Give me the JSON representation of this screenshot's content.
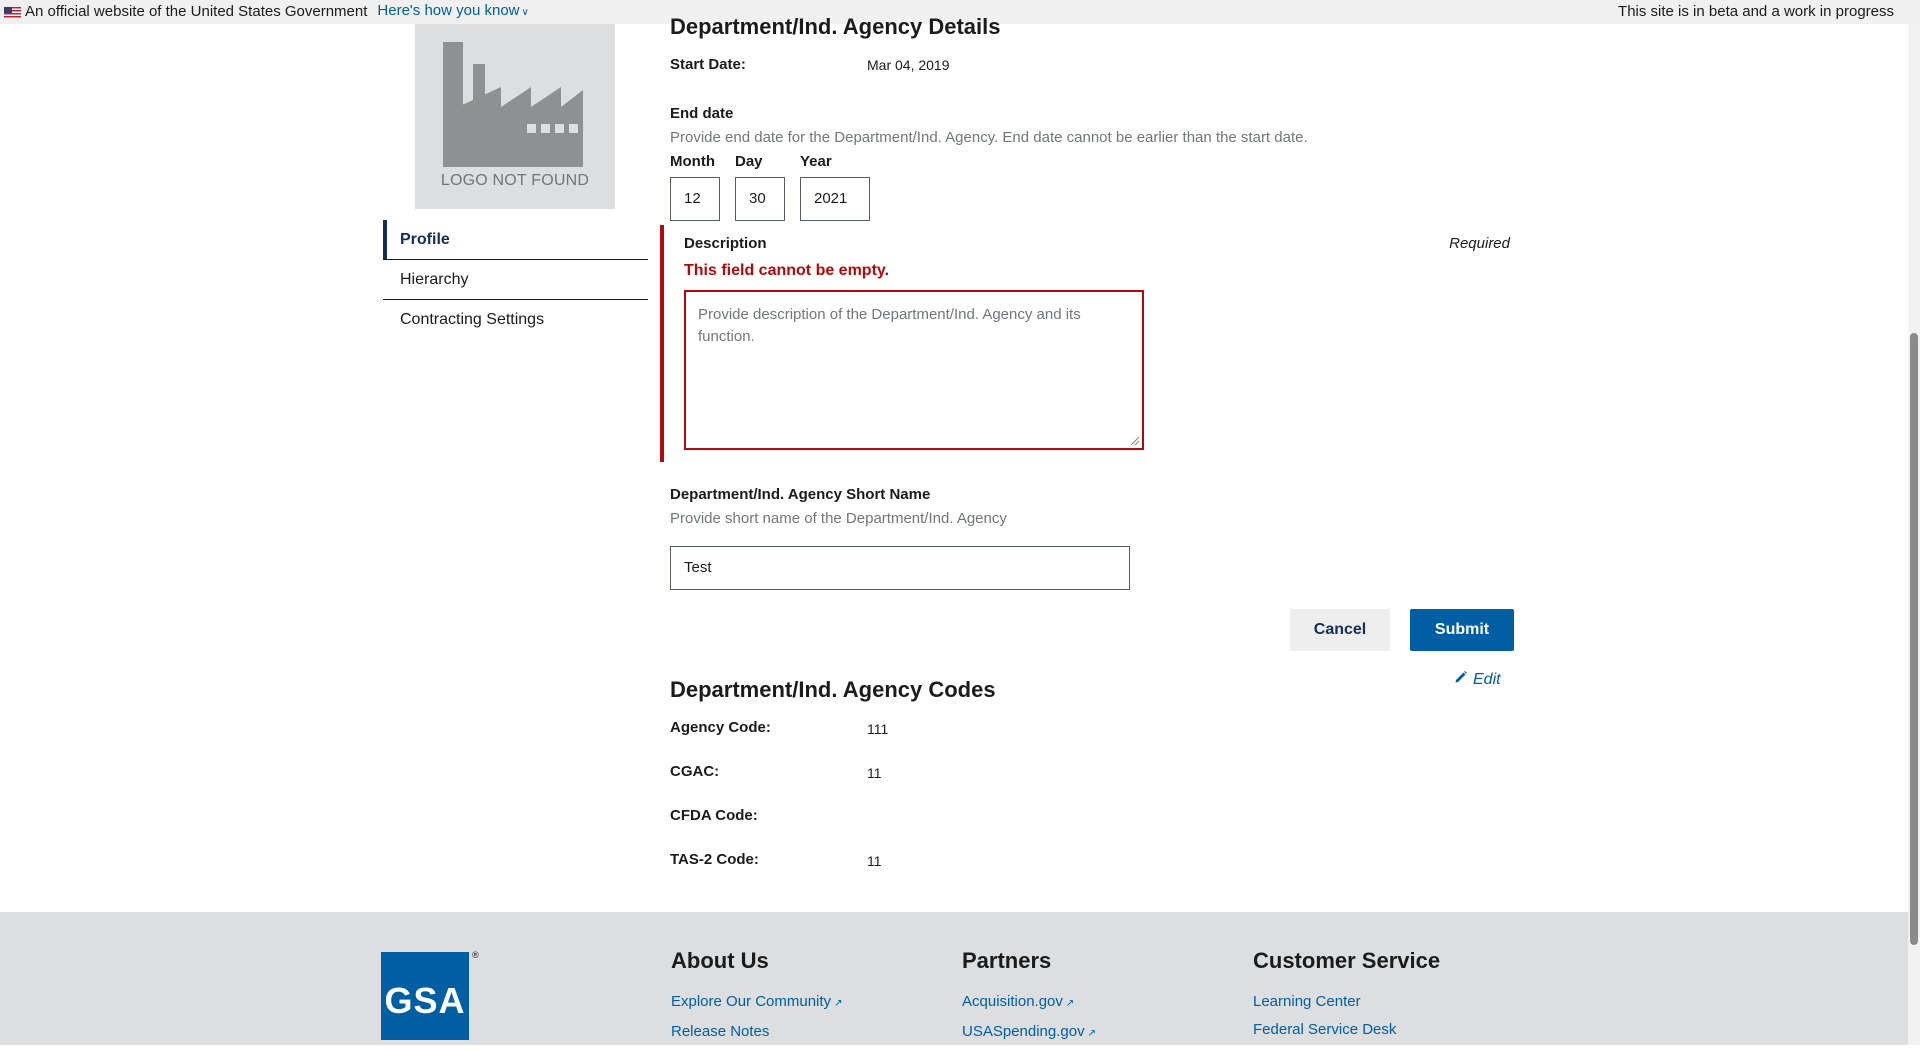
{
  "banner": {
    "official_text": "An official website of the United States Government",
    "how_know": "Here's how you know",
    "beta_text": "This site is in beta and a work in progress"
  },
  "sidebar": {
    "logo_caption": "LOGO NOT FOUND",
    "items": [
      {
        "label": "Profile"
      },
      {
        "label": "Hierarchy"
      },
      {
        "label": "Contracting Settings"
      }
    ]
  },
  "details": {
    "heading": "Department/Ind. Agency Details",
    "start_date_label": "Start Date:",
    "start_date_value": "Mar 04, 2019",
    "end_date_label": "End date",
    "end_date_hint": "Provide end date for the Department/Ind. Agency. End date cannot be earlier than the start date.",
    "month_label": "Month",
    "day_label": "Day",
    "year_label": "Year",
    "month_value": "12",
    "day_value": "30",
    "year_value": "2021",
    "description_label": "Description",
    "required_text": "Required",
    "error_text": "This field cannot be empty.",
    "description_placeholder": "Provide description of the Department/Ind. Agency and its function.",
    "short_name_label": "Department/Ind. Agency Short Name",
    "short_name_hint": "Provide short name of the Department/Ind. Agency",
    "short_name_value": "Test",
    "cancel_label": "Cancel",
    "submit_label": "Submit"
  },
  "codes": {
    "heading": "Department/Ind. Agency Codes",
    "edit_label": "Edit",
    "rows": [
      {
        "label": "Agency Code:",
        "value": "111"
      },
      {
        "label": "CGAC:",
        "value": "11"
      },
      {
        "label": "CFDA Code:",
        "value": ""
      },
      {
        "label": "TAS-2 Code:",
        "value": "11"
      }
    ]
  },
  "footer": {
    "logo_text": "GSA",
    "reg_mark": "®",
    "columns": [
      {
        "title": "About Us",
        "links": [
          "Explore Our Community",
          "Release Notes"
        ]
      },
      {
        "title": "Partners",
        "links": [
          "Acquisition.gov",
          "USASpending.gov"
        ]
      },
      {
        "title": "Customer Service",
        "links": [
          "Learning Center",
          "Federal Service Desk"
        ]
      }
    ]
  },
  "colors": {
    "primary": "#005ea2",
    "error": "#b50909",
    "navy": "#162e51"
  }
}
